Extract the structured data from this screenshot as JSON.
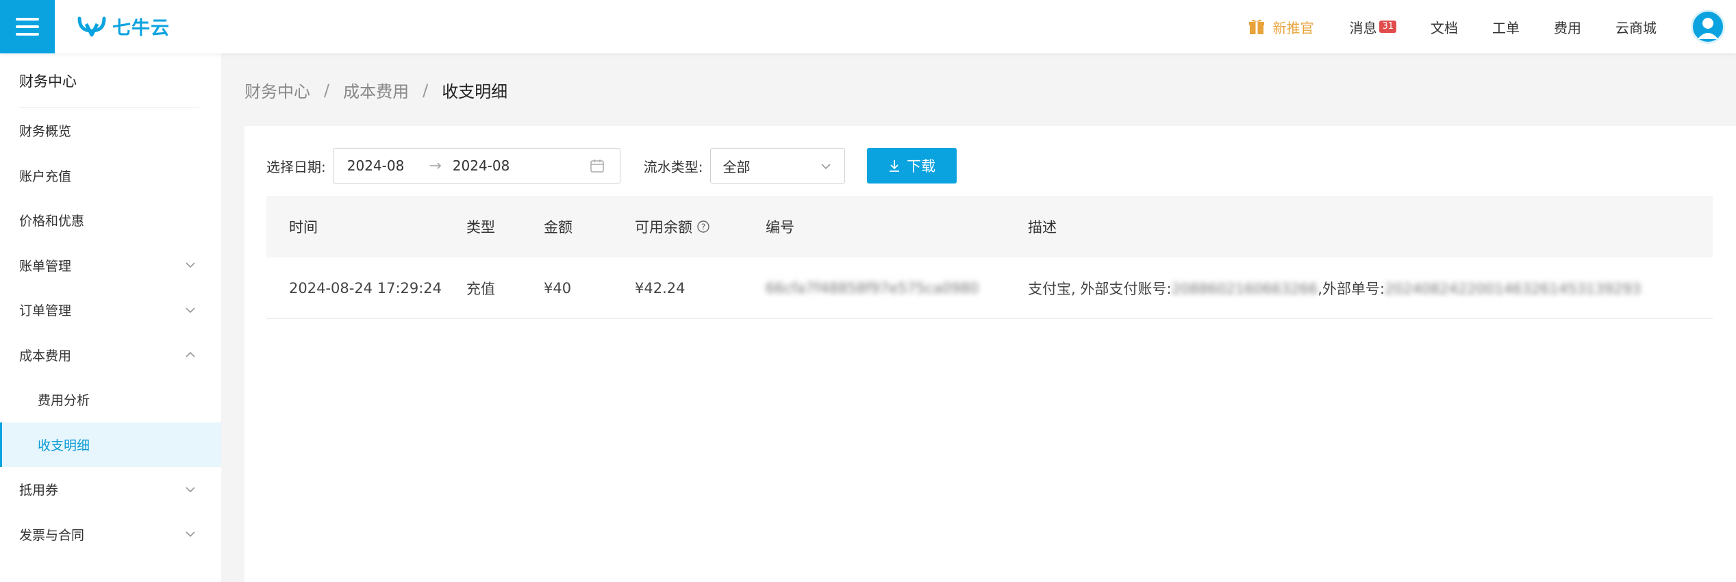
{
  "header": {
    "logo_text": "七牛云",
    "nav": {
      "promo": "新推官",
      "messages": "消息",
      "messages_badge": "31",
      "docs": "文档",
      "tickets": "工单",
      "billing": "费用",
      "mall": "云商城"
    }
  },
  "sidebar": {
    "title": "财务中心",
    "items": [
      {
        "label": "财务概览"
      },
      {
        "label": "账户充值"
      },
      {
        "label": "价格和优惠"
      },
      {
        "label": "账单管理"
      },
      {
        "label": "订单管理"
      },
      {
        "label": "成本费用"
      },
      {
        "label": "费用分析"
      },
      {
        "label": "收支明细"
      },
      {
        "label": "抵用券"
      },
      {
        "label": "发票与合同"
      }
    ]
  },
  "breadcrumb": {
    "level1": "财务中心",
    "level2": "成本费用",
    "current": "收支明细",
    "sep": "/"
  },
  "filters": {
    "date_label": "选择日期:",
    "date_start": "2024-08",
    "date_end": "2024-08",
    "type_label": "流水类型:",
    "type_value": "全部",
    "download_label": "下载"
  },
  "table": {
    "columns": [
      "时间",
      "类型",
      "金额",
      "可用余额",
      "编号",
      "描述"
    ],
    "rows": [
      {
        "time": "2024-08-24 17:29:24",
        "type": "充值",
        "amount": "¥40",
        "balance": "¥42.24",
        "serial": "66cfa7f48858f97e575ca0980",
        "desc_prefix": "支付宝, 外部支付账号:",
        "desc_account": "2088602160663266",
        "desc_mid": ",外部单号:",
        "desc_order": "2024082422001463261453139293"
      }
    ]
  },
  "colors": {
    "accent": "#0aa3e0",
    "promo": "#e8a33a",
    "badge": "#e14c4c"
  }
}
